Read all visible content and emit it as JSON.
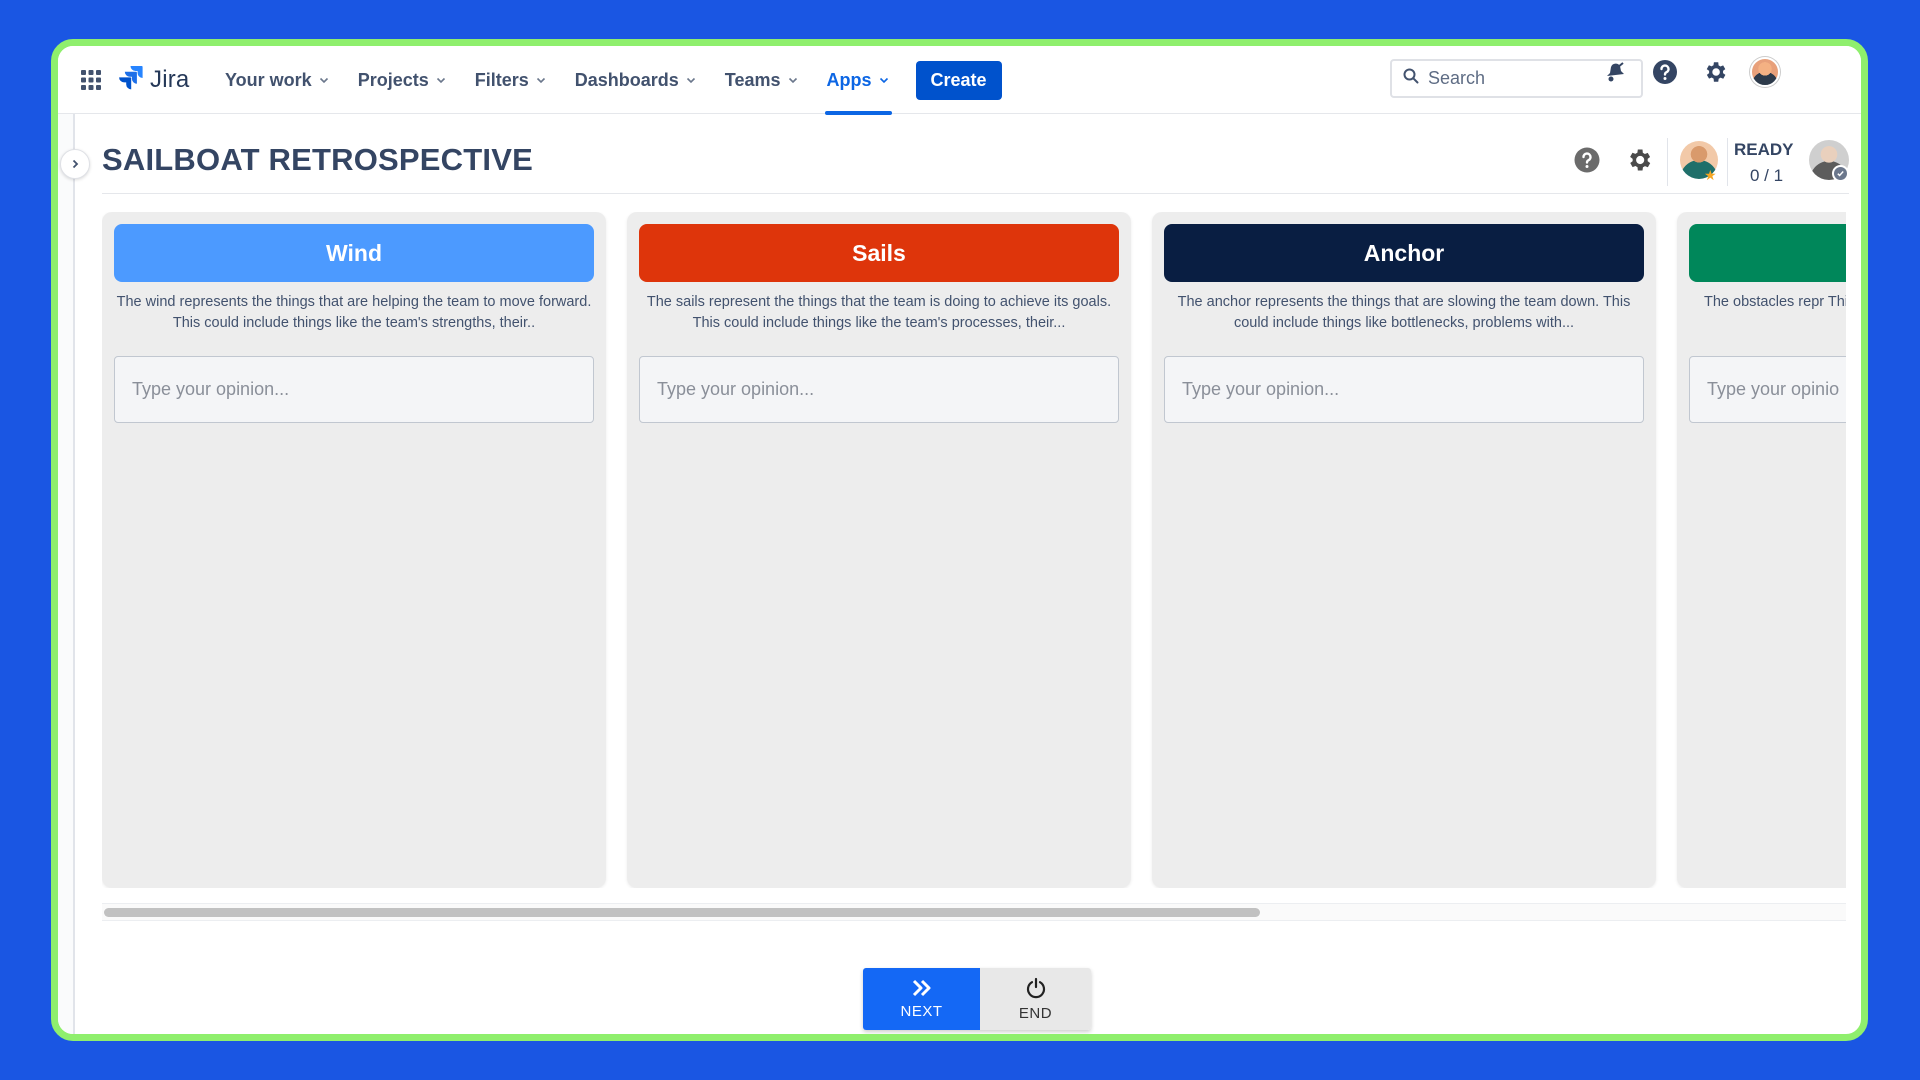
{
  "topnav": {
    "logo_text": "Jira",
    "items": [
      {
        "label": "Your work",
        "active": false
      },
      {
        "label": "Projects",
        "active": false
      },
      {
        "label": "Filters",
        "active": false
      },
      {
        "label": "Dashboards",
        "active": false
      },
      {
        "label": "Teams",
        "active": false
      },
      {
        "label": "Apps",
        "active": true
      }
    ],
    "create_label": "Create",
    "search_placeholder": "Search",
    "icons": [
      "app-switcher-icon",
      "notifications-icon",
      "help-icon",
      "settings-icon",
      "profile-avatar"
    ]
  },
  "page": {
    "title": "SAILBOAT RETROSPECTIVE",
    "ready_label": "READY",
    "ready_count": "0 / 1"
  },
  "columns": [
    {
      "title": "Wind",
      "color": "#4c9aff",
      "description": "The wind represents the things that are helping the team to move forward. This could include things like the team's strengths, their..",
      "input_placeholder": "Type your opinion..."
    },
    {
      "title": "Sails",
      "color": "#de350b",
      "description": "The sails represent the things that the team is doing to achieve its goals. This could include things like the team's processes, their...",
      "input_placeholder": "Type your opinion..."
    },
    {
      "title": "Anchor",
      "color": "#091e42",
      "description": "The anchor represents the things that are slowing the team down. This could include things like bottlenecks, problems with...",
      "input_placeholder": "Type your opinion..."
    },
    {
      "title": "",
      "color": "#00875a",
      "description": "The obstacles repr This could include",
      "input_placeholder": "Type your opinio"
    }
  ],
  "controls": {
    "next_label": "NEXT",
    "end_label": "END"
  },
  "colors": {
    "background": "#1a56e3",
    "frame": "#8fef6d",
    "primary": "#0052cc"
  }
}
